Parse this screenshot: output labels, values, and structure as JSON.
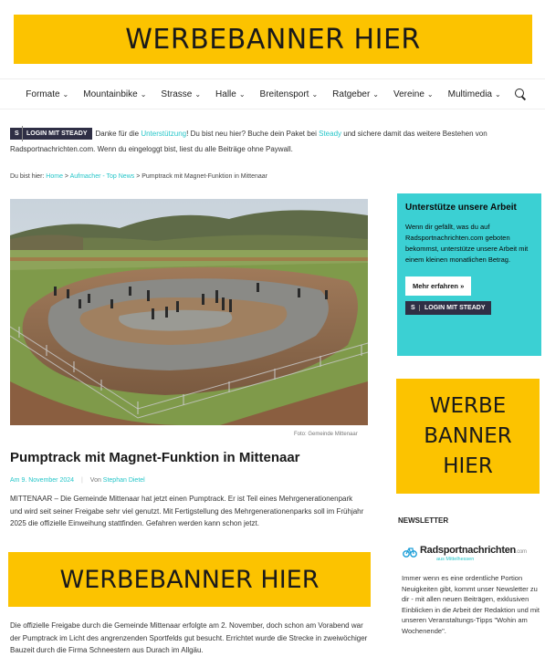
{
  "banners": {
    "top": "WERBEBANNER HIER",
    "middle": "WERBEBANNER HIER",
    "side": [
      "WERBE",
      "BANNER",
      "HIER"
    ]
  },
  "nav": {
    "items": [
      "Formate",
      "Mountainbike",
      "Strasse",
      "Halle",
      "Breitensport",
      "Ratgeber",
      "Vereine",
      "Multimedia"
    ]
  },
  "steady": {
    "badge": "LOGIN MIT STEADY",
    "text1": "Danke für die ",
    "link1": "Unterstützung",
    "text2": "! Du bist neu hier? Buche dein Paket bei ",
    "link2": "Steady",
    "text3": " und sichere damit das weitere Bestehen von Radsportnachrichten.com. Wenn du eingeloggt bist, liest du alle Beiträge ohne Paywall."
  },
  "breadcrumb": {
    "prefix": "Du bist hier: ",
    "home": "Home",
    "section": "Aufmacher - Top News",
    "current": "Pumptrack mit Magnet-Funktion in Mittenaar"
  },
  "article": {
    "photo_caption": "Foto: Gemeinde Mittenaar",
    "title": "Pumptrack mit Magnet-Funktion in Mittenaar",
    "date": "Am 9. November 2024",
    "author_prefix": "Von ",
    "author": "Stephan Dietel",
    "body1": "MITTENAAR – Die Gemeinde Mittenaar hat jetzt einen Pumptrack. Er ist Teil eines Mehrgenerationenpark und wird seit seiner Freigabe sehr viel genutzt. Mit Fertigstellung des Mehrgenerationenparks soll im Frühjahr 2025 die offizielle Einweihung stattfinden. Gefahren werden kann schon jetzt.",
    "body2": "Die offizielle Freigabe durch die Gemeinde Mittenaar erfolgte am 2. November, doch schon am Vorabend war der Pumptrack im Licht des angrenzenden Sportfelds gut besucht. Errichtet wurde die Strecke in zweiwöchiger Bauzeit durch die Firma Schneestern aus Durach im Allgäu."
  },
  "sidebar": {
    "support_title": "Unterstütze unsere Arbeit",
    "support_text": "Wenn dir gefällt, was du auf Radsportnachrichten.com geboten bekommst, unterstütze unsere Arbeit mit einem kleinen monatlichen Betrag.",
    "more_button": "Mehr erfahren »",
    "steady_button": "LOGIN MIT STEADY",
    "newsletter_heading": "NEWSLETTER",
    "logo_name": "Radsportnachrichten",
    "logo_tld": ".com",
    "logo_sub": "aus Mittelhessen",
    "newsletter_text": "Immer wenn es eine ordentliche Portion Neuigkeiten gibt, kommt unser Newsletter zu dir - mit allen neuen Beiträgen, exklusiven Einblicken in die Arbeit der Redaktion und mit unseren Veranstaltungs-Tipps \"Wohin am Wochenende\"."
  },
  "colors": {
    "banner_yellow": "#fcc300",
    "accent_teal": "#3bd0d3",
    "link_teal": "#26c6c9",
    "steady_dark": "#2f2f45"
  }
}
